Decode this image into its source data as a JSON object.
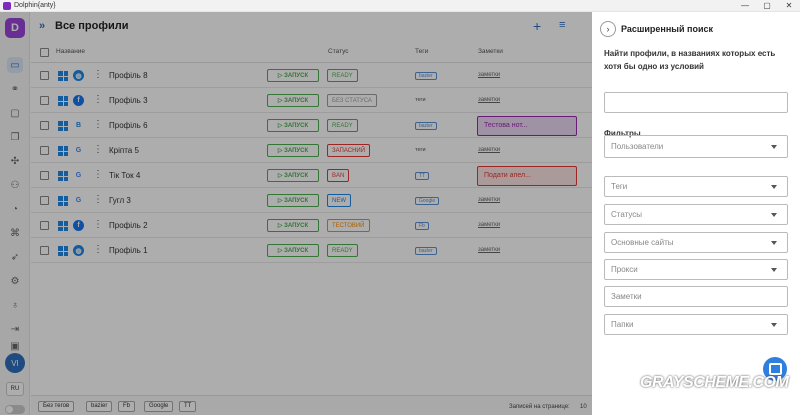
{
  "window": {
    "title": "Dolphin{anty}",
    "minimize": "—",
    "maximize": "▢",
    "close": "✕"
  },
  "sidebar": {
    "logo": "D",
    "avatar": "VI",
    "lang": "RU"
  },
  "header": {
    "chevrons": "»",
    "title": "Все профили",
    "add": "+",
    "filter": "⚲"
  },
  "columns": {
    "name": "Название",
    "status": "Статус",
    "tags": "Теги",
    "notes": "Заметки"
  },
  "run_label": "▷ ЗАПУСК",
  "rows": [
    {
      "name": "Профіль 8",
      "browser": "globe",
      "status": "READY",
      "status_color": "#4caf50",
      "tag": "bazier",
      "tag_type": "chip",
      "notes": "заметки",
      "note_box": ""
    },
    {
      "name": "Профіль 3",
      "browser": "facebook",
      "status": "БЕЗ СТАТУСА",
      "status_color": "#9e9e9e",
      "tag": "теги",
      "tag_type": "text",
      "notes": "заметки",
      "note_box": ""
    },
    {
      "name": "Профіль 6",
      "browser": "bitcoin",
      "status": "READY",
      "status_color": "#4caf50",
      "tag": "bazier",
      "tag_type": "chip",
      "notes": "",
      "note_box": "Тестова нот..."
    },
    {
      "name": "Кріпта 5",
      "browser": "google",
      "status": "ЗАПАСНИЙ",
      "status_color": "#e53935",
      "tag": "теги",
      "tag_type": "text",
      "notes": "заметки",
      "note_box": ""
    },
    {
      "name": "Тік Ток 4",
      "browser": "google",
      "status": "BAN",
      "status_color": "#e53935",
      "tag": "TT",
      "tag_type": "chip",
      "notes": "",
      "note_box": "Подати апел..."
    },
    {
      "name": "Гугл 3",
      "browser": "google",
      "status": "NEW",
      "status_color": "#1e88e5",
      "tag": "Google",
      "tag_type": "chip",
      "notes": "заметки",
      "note_box": ""
    },
    {
      "name": "Профіль 2",
      "browser": "facebook",
      "status": "ТЕСТОВИЙ",
      "status_color": "#fb8c00",
      "tag": "Fb",
      "tag_type": "chip",
      "notes": "заметки",
      "note_box": ""
    },
    {
      "name": "Профіль 1",
      "browser": "globe",
      "status": "READY",
      "status_color": "#4caf50",
      "tag": "bazier",
      "tag_type": "chip",
      "notes": "заметки",
      "note_box": ""
    }
  ],
  "footer": {
    "tags": [
      "Без тегов",
      "bazier",
      "Fb",
      "Google",
      "TT"
    ],
    "per_page_label": "Записей на странице:",
    "per_page_value": "10"
  },
  "panel": {
    "back": "›",
    "title": "Расширенный поиск",
    "subtitle": "Найти профили, в названиях которых есть хотя бы одно из условий",
    "filters_label": "Фильтры",
    "fields": [
      "Пользователи",
      "Теги",
      "Статусы",
      "Основные сайты",
      "Прокси",
      "Заметки",
      "Папки"
    ]
  },
  "watermark": "GRAYSCHEME.COM"
}
